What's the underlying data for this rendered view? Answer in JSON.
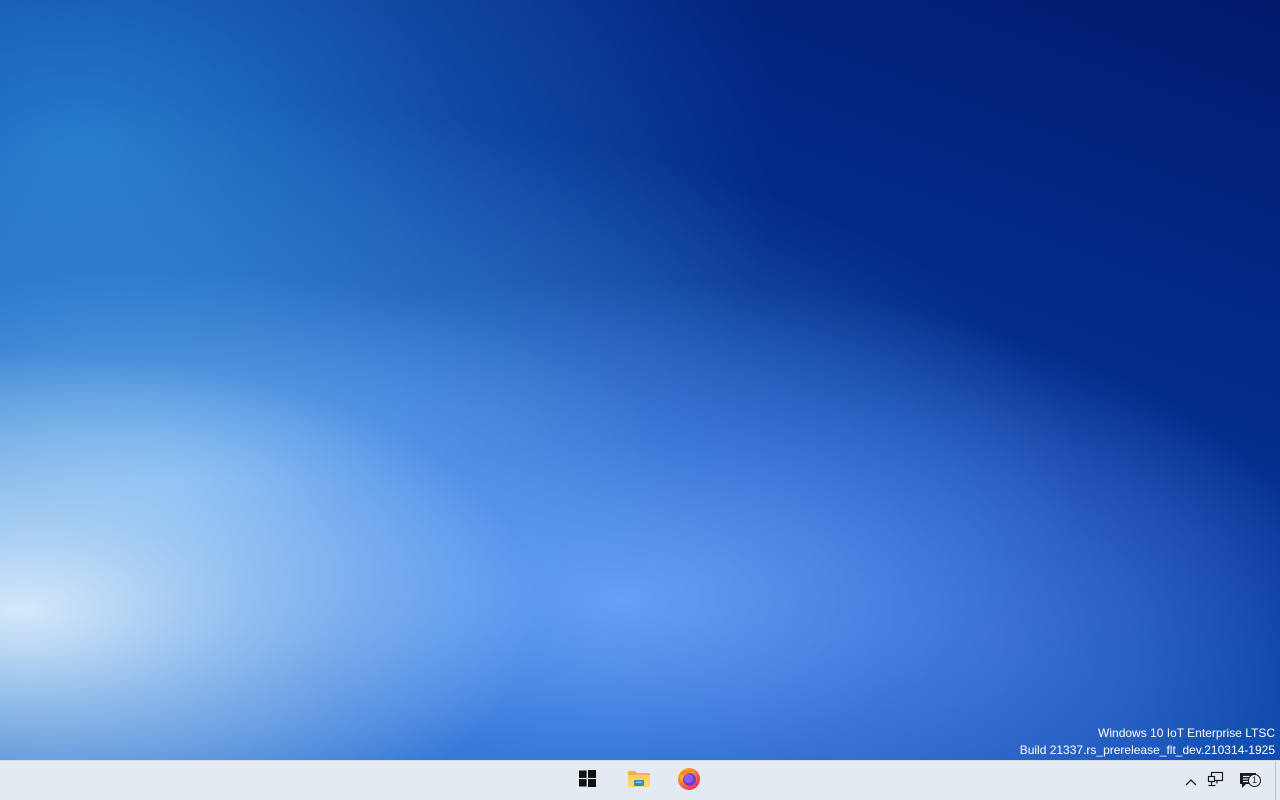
{
  "desktop": {
    "watermark": {
      "edition": "Windows 10 IoT Enterprise LTSC",
      "build": "Build 21337.rs_prerelease_flt_dev.210314-1925"
    }
  },
  "taskbar": {
    "pinned": [
      {
        "name": "start",
        "icon": "windows-logo-icon"
      },
      {
        "name": "file-explorer",
        "icon": "folder-icon"
      },
      {
        "name": "firefox",
        "icon": "firefox-icon"
      }
    ],
    "tray": {
      "show_hidden_icon": "chevron-up-icon",
      "network_icon": "network-icon",
      "notification_icon": "action-center-icon",
      "notification_count": "1"
    }
  },
  "colors": {
    "taskbar_bg": "#e4eaf2",
    "text_on_desktop": "#ffffff"
  }
}
